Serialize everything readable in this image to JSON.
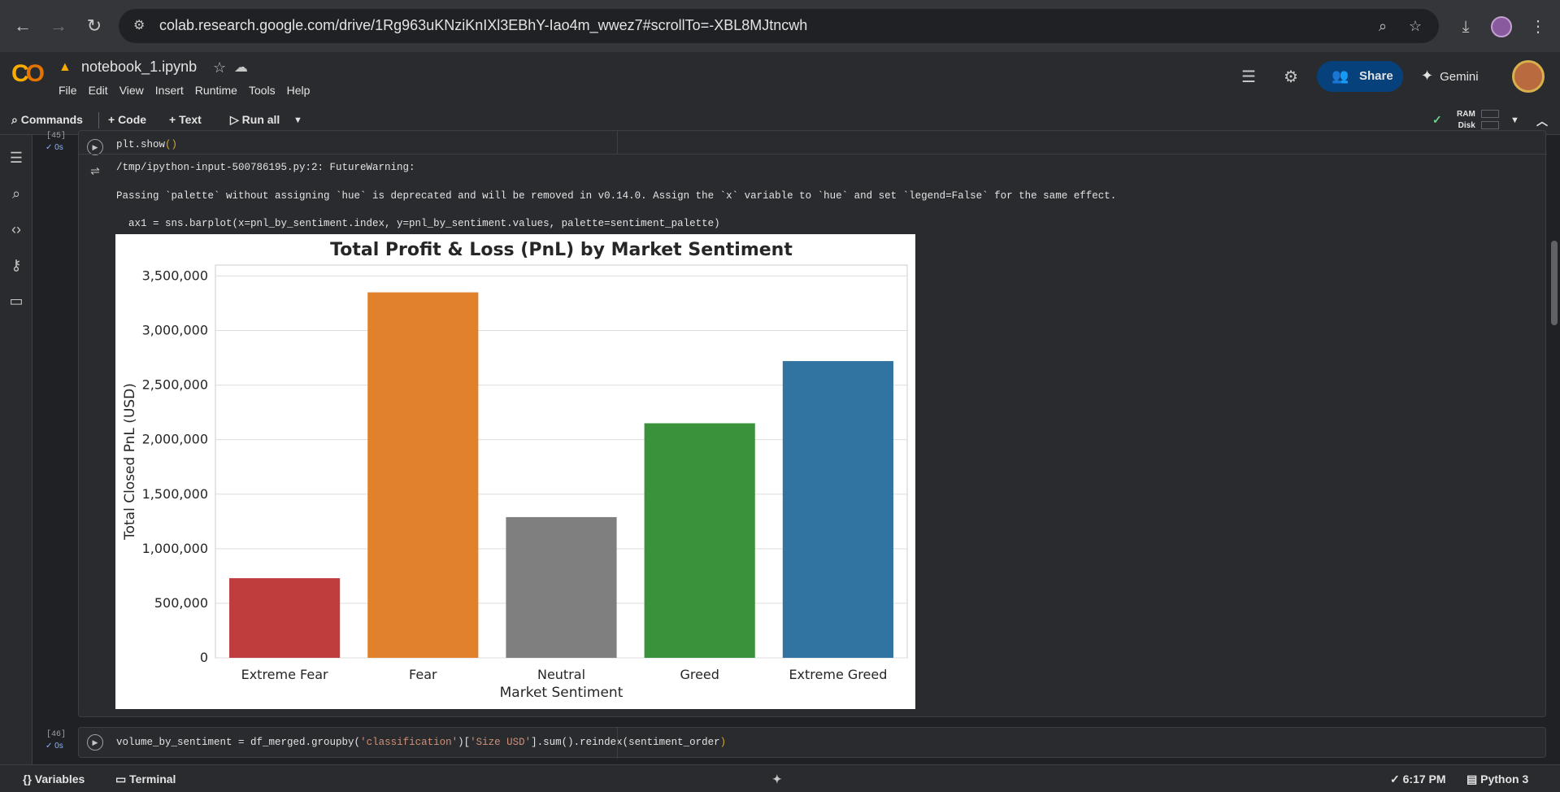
{
  "browser": {
    "url": "colab.research.google.com/drive/1Rg963uKNziKnIXl3EBhY-Iao4m_wwez7#scrollTo=-XBL8MJtncwh"
  },
  "header": {
    "notebook_name": "notebook_1.ipynb",
    "menu": [
      "File",
      "Edit",
      "View",
      "Insert",
      "Runtime",
      "Tools",
      "Help"
    ],
    "share_label": "Share",
    "gemini_label": "Gemini"
  },
  "toolbar": {
    "commands": "Commands",
    "code": "+ Code",
    "text": "+ Text",
    "run_all": "Run all",
    "ram": "RAM",
    "disk": "Disk"
  },
  "cell1": {
    "exec_count": "[45]",
    "exec_time": "0s",
    "code": "plt.show",
    "paren": "()",
    "output": {
      "warning_header": "/tmp/ipython-input-500786195.py:2: FutureWarning:",
      "warning_text": "Passing `palette` without assigning `hue` is deprecated and will be removed in v0.14.0. Assign the `x` variable to `hue` and set `legend=False` for the same effect.",
      "warning_code": "  ax1 = sns.barplot(x=pnl_by_sentiment.index, y=pnl_by_sentiment.values, palette=sentiment_palette)"
    }
  },
  "cell2": {
    "exec_count": "[46]",
    "exec_time": "0s",
    "code_pre": "volume_by_sentiment = df_merged.groupby(",
    "code_s1": "'classification'",
    "code_mid": ")[",
    "code_s2": "'Size USD'",
    "code_post": "].sum().reindex(sentiment_order",
    "code_end": ")"
  },
  "chart_data": {
    "type": "bar",
    "title": "Total Profit & Loss (PnL) by Market Sentiment",
    "xlabel": "Market Sentiment",
    "ylabel": "Total Closed PnL (USD)",
    "categories": [
      "Extreme Fear",
      "Fear",
      "Neutral",
      "Greed",
      "Extreme Greed"
    ],
    "values": [
      730000,
      3350000,
      1290000,
      2150000,
      2720000
    ],
    "colors": [
      "#c03d3e",
      "#e1812c",
      "#7f7f7f",
      "#3a923a",
      "#3274a1"
    ],
    "ylim": [
      0,
      3600000
    ],
    "yticks": [
      "0",
      "500,000",
      "1,000,000",
      "1,500,000",
      "2,000,000",
      "2,500,000",
      "3,000,000",
      "3,500,000"
    ],
    "ytick_values": [
      0,
      500000,
      1000000,
      1500000,
      2000000,
      2500000,
      3000000,
      3500000
    ],
    "grid": true
  },
  "status": {
    "variables": "Variables",
    "terminal": "Terminal",
    "time": "6:17 PM",
    "runtime": "Python 3"
  }
}
